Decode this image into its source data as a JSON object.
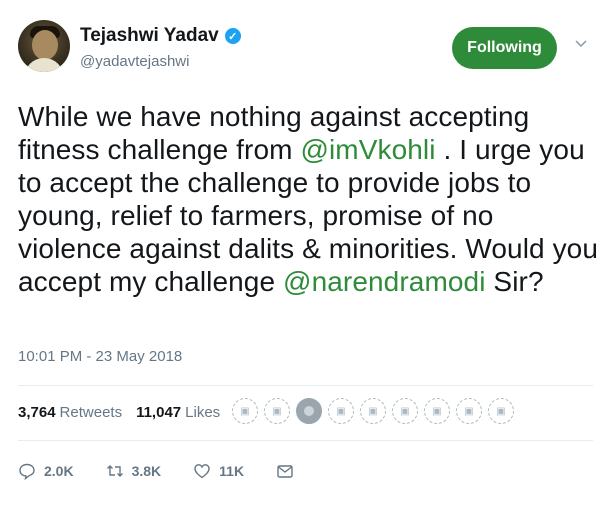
{
  "author": {
    "name": "Tejashwi Yadav",
    "handle": "@yadavtejashwi",
    "verified": true
  },
  "follow_button": {
    "label": "Following",
    "color": "#2e8b3a"
  },
  "tweet": {
    "part1": "While we have nothing against accepting fitness challenge from ",
    "mention1": "@imVkohli",
    "part2": " . I urge you to accept the challenge to provide jobs to young, relief to farmers, promise of no violence against dalits & minorities. Would you accept my challenge ",
    "mention2": "@narendramodi",
    "part3": " Sir?"
  },
  "timestamp": "10:01 PM - 23 May 2018",
  "stats": {
    "retweets_count": "3,764",
    "retweets_label": "Retweets",
    "likes_count": "11,047",
    "likes_label": "Likes"
  },
  "actions": {
    "reply_count": "2.0K",
    "retweet_count": "3.8K",
    "like_count": "11K"
  },
  "icons": [
    "chevron-down-icon",
    "verified-badge-icon",
    "reply-icon",
    "retweet-icon",
    "like-icon",
    "message-icon"
  ]
}
